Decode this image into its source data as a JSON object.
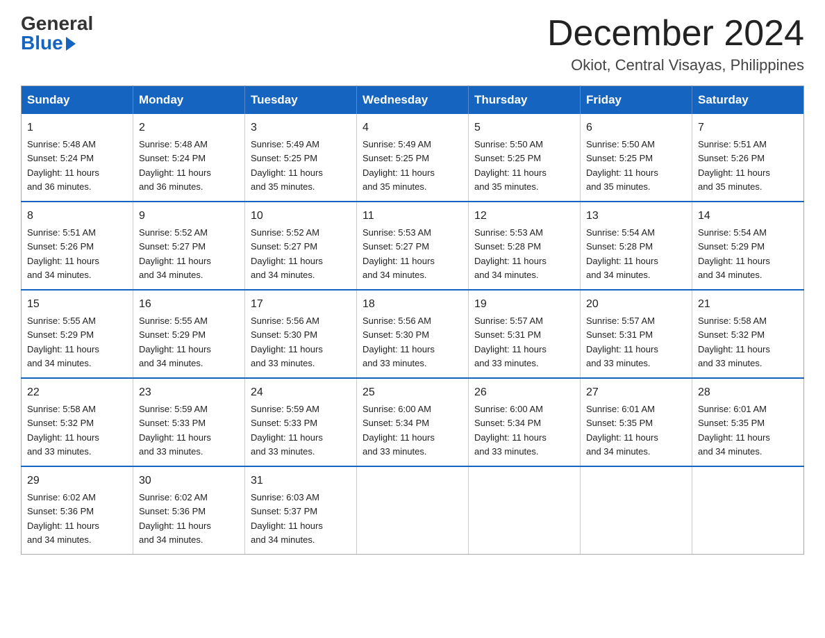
{
  "logo": {
    "general": "General",
    "blue": "Blue"
  },
  "title": "December 2024",
  "subtitle": "Okiot, Central Visayas, Philippines",
  "days_of_week": [
    "Sunday",
    "Monday",
    "Tuesday",
    "Wednesday",
    "Thursday",
    "Friday",
    "Saturday"
  ],
  "weeks": [
    [
      {
        "day": "1",
        "sunrise": "5:48 AM",
        "sunset": "5:24 PM",
        "daylight": "11 hours and 36 minutes."
      },
      {
        "day": "2",
        "sunrise": "5:48 AM",
        "sunset": "5:24 PM",
        "daylight": "11 hours and 36 minutes."
      },
      {
        "day": "3",
        "sunrise": "5:49 AM",
        "sunset": "5:25 PM",
        "daylight": "11 hours and 35 minutes."
      },
      {
        "day": "4",
        "sunrise": "5:49 AM",
        "sunset": "5:25 PM",
        "daylight": "11 hours and 35 minutes."
      },
      {
        "day": "5",
        "sunrise": "5:50 AM",
        "sunset": "5:25 PM",
        "daylight": "11 hours and 35 minutes."
      },
      {
        "day": "6",
        "sunrise": "5:50 AM",
        "sunset": "5:25 PM",
        "daylight": "11 hours and 35 minutes."
      },
      {
        "day": "7",
        "sunrise": "5:51 AM",
        "sunset": "5:26 PM",
        "daylight": "11 hours and 35 minutes."
      }
    ],
    [
      {
        "day": "8",
        "sunrise": "5:51 AM",
        "sunset": "5:26 PM",
        "daylight": "11 hours and 34 minutes."
      },
      {
        "day": "9",
        "sunrise": "5:52 AM",
        "sunset": "5:27 PM",
        "daylight": "11 hours and 34 minutes."
      },
      {
        "day": "10",
        "sunrise": "5:52 AM",
        "sunset": "5:27 PM",
        "daylight": "11 hours and 34 minutes."
      },
      {
        "day": "11",
        "sunrise": "5:53 AM",
        "sunset": "5:27 PM",
        "daylight": "11 hours and 34 minutes."
      },
      {
        "day": "12",
        "sunrise": "5:53 AM",
        "sunset": "5:28 PM",
        "daylight": "11 hours and 34 minutes."
      },
      {
        "day": "13",
        "sunrise": "5:54 AM",
        "sunset": "5:28 PM",
        "daylight": "11 hours and 34 minutes."
      },
      {
        "day": "14",
        "sunrise": "5:54 AM",
        "sunset": "5:29 PM",
        "daylight": "11 hours and 34 minutes."
      }
    ],
    [
      {
        "day": "15",
        "sunrise": "5:55 AM",
        "sunset": "5:29 PM",
        "daylight": "11 hours and 34 minutes."
      },
      {
        "day": "16",
        "sunrise": "5:55 AM",
        "sunset": "5:29 PM",
        "daylight": "11 hours and 34 minutes."
      },
      {
        "day": "17",
        "sunrise": "5:56 AM",
        "sunset": "5:30 PM",
        "daylight": "11 hours and 33 minutes."
      },
      {
        "day": "18",
        "sunrise": "5:56 AM",
        "sunset": "5:30 PM",
        "daylight": "11 hours and 33 minutes."
      },
      {
        "day": "19",
        "sunrise": "5:57 AM",
        "sunset": "5:31 PM",
        "daylight": "11 hours and 33 minutes."
      },
      {
        "day": "20",
        "sunrise": "5:57 AM",
        "sunset": "5:31 PM",
        "daylight": "11 hours and 33 minutes."
      },
      {
        "day": "21",
        "sunrise": "5:58 AM",
        "sunset": "5:32 PM",
        "daylight": "11 hours and 33 minutes."
      }
    ],
    [
      {
        "day": "22",
        "sunrise": "5:58 AM",
        "sunset": "5:32 PM",
        "daylight": "11 hours and 33 minutes."
      },
      {
        "day": "23",
        "sunrise": "5:59 AM",
        "sunset": "5:33 PM",
        "daylight": "11 hours and 33 minutes."
      },
      {
        "day": "24",
        "sunrise": "5:59 AM",
        "sunset": "5:33 PM",
        "daylight": "11 hours and 33 minutes."
      },
      {
        "day": "25",
        "sunrise": "6:00 AM",
        "sunset": "5:34 PM",
        "daylight": "11 hours and 33 minutes."
      },
      {
        "day": "26",
        "sunrise": "6:00 AM",
        "sunset": "5:34 PM",
        "daylight": "11 hours and 33 minutes."
      },
      {
        "day": "27",
        "sunrise": "6:01 AM",
        "sunset": "5:35 PM",
        "daylight": "11 hours and 34 minutes."
      },
      {
        "day": "28",
        "sunrise": "6:01 AM",
        "sunset": "5:35 PM",
        "daylight": "11 hours and 34 minutes."
      }
    ],
    [
      {
        "day": "29",
        "sunrise": "6:02 AM",
        "sunset": "5:36 PM",
        "daylight": "11 hours and 34 minutes."
      },
      {
        "day": "30",
        "sunrise": "6:02 AM",
        "sunset": "5:36 PM",
        "daylight": "11 hours and 34 minutes."
      },
      {
        "day": "31",
        "sunrise": "6:03 AM",
        "sunset": "5:37 PM",
        "daylight": "11 hours and 34 minutes."
      },
      null,
      null,
      null,
      null
    ]
  ],
  "labels": {
    "sunrise": "Sunrise:",
    "sunset": "Sunset:",
    "daylight": "Daylight:"
  }
}
